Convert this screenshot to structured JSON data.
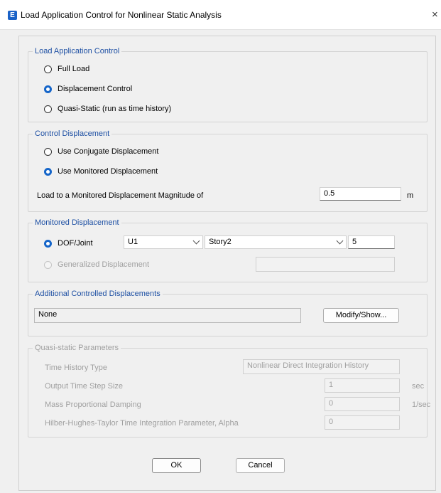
{
  "window": {
    "app_icon_letter": "E",
    "title": "Load Application Control for Nonlinear Static Analysis",
    "close_glyph": "×"
  },
  "load_application_control": {
    "legend": "Load Application Control",
    "options": [
      "Full Load",
      "Displacement Control",
      "Quasi-Static (run as time history)"
    ],
    "selected": "Displacement Control"
  },
  "control_displacement": {
    "legend": "Control Displacement",
    "options": [
      "Use Conjugate Displacement",
      "Use Monitored Displacement"
    ],
    "selected": "Use Monitored Displacement",
    "magnitude_label": "Load to a Monitored Displacement Magnitude of",
    "magnitude_value": "0.5",
    "magnitude_unit": "m"
  },
  "monitored_displacement": {
    "legend": "Monitored Displacement",
    "dof_joint_label": "DOF/Joint",
    "dof_value": "U1",
    "story_value": "Story2",
    "joint_value": "5",
    "generalized_label": "Generalized Displacement",
    "generalized_value": ""
  },
  "additional_controlled": {
    "legend": "Additional Controlled Displacements",
    "value": "None",
    "button": "Modify/Show..."
  },
  "quasi_static": {
    "legend": "Quasi-static Parameters",
    "time_history_type_label": "Time History Type",
    "time_history_type_value": "Nonlinear Direct Integration History",
    "output_step_label": "Output Time Step Size",
    "output_step_value": "1",
    "output_step_unit": "sec",
    "mass_damping_label": "Mass Proportional Damping",
    "mass_damping_value": "0",
    "mass_damping_unit": "1/sec",
    "hht_label": "Hilber-Hughes-Taylor Time Integration Parameter, Alpha",
    "hht_value": "0"
  },
  "buttons": {
    "ok": "OK",
    "cancel": "Cancel"
  },
  "colors": {
    "accent": "#1565c9",
    "legend": "#1d4fa3",
    "disabled_text": "#a0a0a0"
  }
}
